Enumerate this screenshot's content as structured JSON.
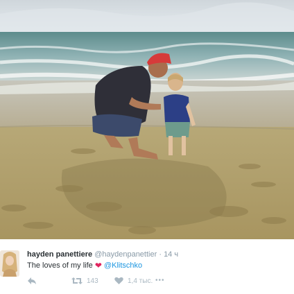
{
  "tweet": {
    "name": "hayden panettiere",
    "handle": "@haydenpanettier",
    "separator": "·",
    "time": "14 ч",
    "text": "The loves of my life",
    "mention": "@Klitschko",
    "retweet_count": "143",
    "like_count": "1,4 тыс.",
    "more": "•••"
  },
  "colors": {
    "name": "#292f33",
    "muted": "#8899a6",
    "link": "#1b95e0",
    "heart": "#e0245e",
    "action": "#aab8c2"
  },
  "icons": {
    "reply": "reply-icon",
    "retweet": "retweet-icon",
    "like": "heart-icon",
    "more": "more-icon",
    "emoji": "red-heart-emoji"
  }
}
